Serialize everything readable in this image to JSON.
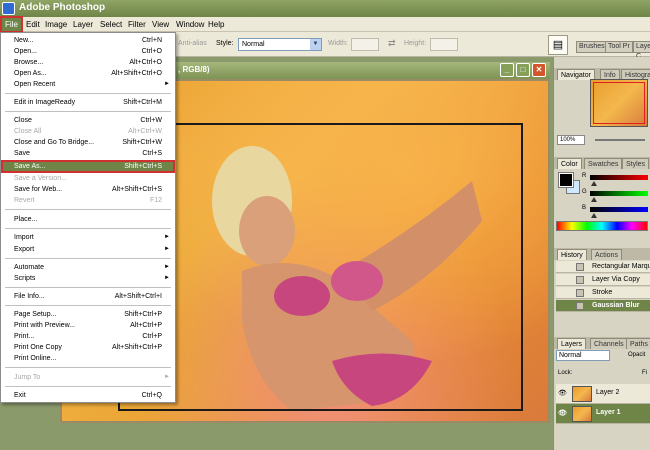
{
  "app": {
    "title": "Adobe Photoshop"
  },
  "menubar": [
    "File",
    "Edit",
    "Image",
    "Layer",
    "Select",
    "Filter",
    "View",
    "Window",
    "Help"
  ],
  "options": {
    "antialias_label": "Anti-alias",
    "style_label": "Style:",
    "style_value": "Normal",
    "width_label": "Width:",
    "height_label": "Height:",
    "well_tabs": [
      "Brushes",
      "Tool Pr",
      "Layer C"
    ]
  },
  "document": {
    "title": ", RGB/8)"
  },
  "file_menu": [
    {
      "label": "New...",
      "shortcut": "Ctrl+N"
    },
    {
      "label": "Open...",
      "shortcut": "Ctrl+O"
    },
    {
      "label": "Browse...",
      "shortcut": "Alt+Ctrl+O"
    },
    {
      "label": "Open As...",
      "shortcut": "Alt+Shift+Ctrl+O"
    },
    {
      "label": "Open Recent",
      "shortcut": ""
    },
    {
      "label": "Edit in ImageReady",
      "shortcut": "Shift+Ctrl+M"
    },
    {
      "label": "Close",
      "shortcut": "Ctrl+W"
    },
    {
      "label": "Close All",
      "shortcut": "Alt+Ctrl+W"
    },
    {
      "label": "Close and Go To Bridge...",
      "shortcut": "Shift+Ctrl+W"
    },
    {
      "label": "Save",
      "shortcut": "Ctrl+S"
    },
    {
      "label": "Save As...",
      "shortcut": "Shift+Ctrl+S"
    },
    {
      "label": "Save a Version...",
      "shortcut": ""
    },
    {
      "label": "Save for Web...",
      "shortcut": "Alt+Shift+Ctrl+S"
    },
    {
      "label": "Revert",
      "shortcut": "F12"
    },
    {
      "label": "Place...",
      "shortcut": ""
    },
    {
      "label": "Import",
      "shortcut": ""
    },
    {
      "label": "Export",
      "shortcut": ""
    },
    {
      "label": "Automate",
      "shortcut": ""
    },
    {
      "label": "Scripts",
      "shortcut": ""
    },
    {
      "label": "File Info...",
      "shortcut": "Alt+Shift+Ctrl+I"
    },
    {
      "label": "Page Setup...",
      "shortcut": "Shift+Ctrl+P"
    },
    {
      "label": "Print with Preview...",
      "shortcut": "Alt+Ctrl+P"
    },
    {
      "label": "Print...",
      "shortcut": "Ctrl+P"
    },
    {
      "label": "Print One Copy",
      "shortcut": "Alt+Shift+Ctrl+P"
    },
    {
      "label": "Print Online...",
      "shortcut": ""
    },
    {
      "label": "Jump To",
      "shortcut": ""
    },
    {
      "label": "Exit",
      "shortcut": "Ctrl+Q"
    }
  ],
  "navigator": {
    "tabs": [
      "Navigator",
      "Info",
      "Histogra"
    ],
    "zoom": "100%"
  },
  "color": {
    "tabs": [
      "Color",
      "Swatches",
      "Styles"
    ],
    "r_label": "R",
    "g_label": "G",
    "b_label": "B"
  },
  "history": {
    "tabs": [
      "History",
      "Actions"
    ],
    "items": [
      "Rectangular Marque",
      "Layer Via Copy",
      "Stroke",
      "Gaussian Blur"
    ]
  },
  "layers": {
    "tabs": [
      "Layers",
      "Channels",
      "Paths"
    ],
    "blend_mode": "Normal",
    "opacity_label": "Opacit",
    "lock_label": "Lock:",
    "fill_label": "Fi",
    "items": [
      "Layer 2",
      "Layer 1"
    ]
  },
  "colors": {
    "accent": "#6f8548",
    "highlight_outline": "#d03030"
  }
}
